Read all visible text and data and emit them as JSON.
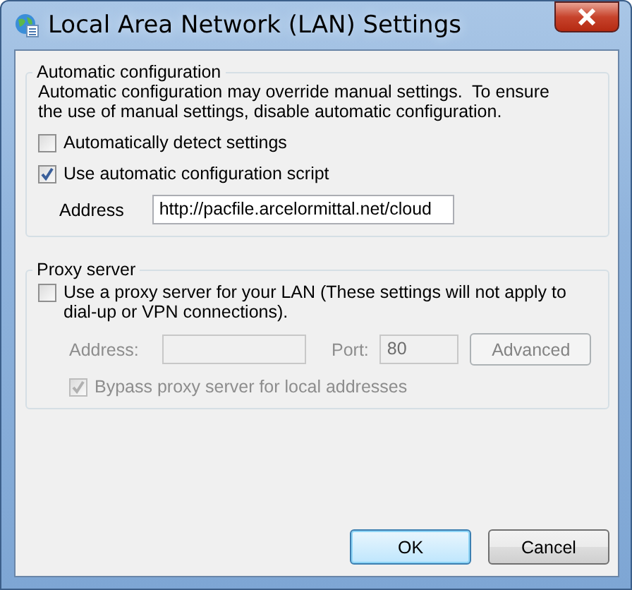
{
  "window": {
    "title": "Local Area Network (LAN) Settings"
  },
  "automatic_configuration": {
    "title": "Automatic configuration",
    "description": "Automatic configuration may override manual settings.  To ensure the use of manual settings, disable automatic configuration.",
    "options": [
      {
        "label": "Automatically detect settings",
        "checked": false
      },
      {
        "label": "Use automatic configuration script",
        "checked": true
      }
    ],
    "address": {
      "label": "Address",
      "value": "http://pacfile.arcelormittal.net/cloud"
    }
  },
  "proxy_server": {
    "title": "Proxy server",
    "use_proxy": {
      "label": "Use a proxy server for your LAN (These settings will not apply to dial-up or VPN connections).",
      "checked": false
    },
    "address": {
      "label": "Address:",
      "disabled": true
    },
    "port": {
      "label": "Port:",
      "value": "80",
      "disabled": true
    },
    "advanced_button": {
      "label": "Advanced",
      "disabled": true
    },
    "bypass": {
      "label": "Bypass proxy server for local addresses",
      "checked": true,
      "disabled": true
    }
  },
  "buttons": [
    {
      "label": "OK",
      "default": true
    },
    {
      "label": "Cancel",
      "default": false
    }
  ]
}
